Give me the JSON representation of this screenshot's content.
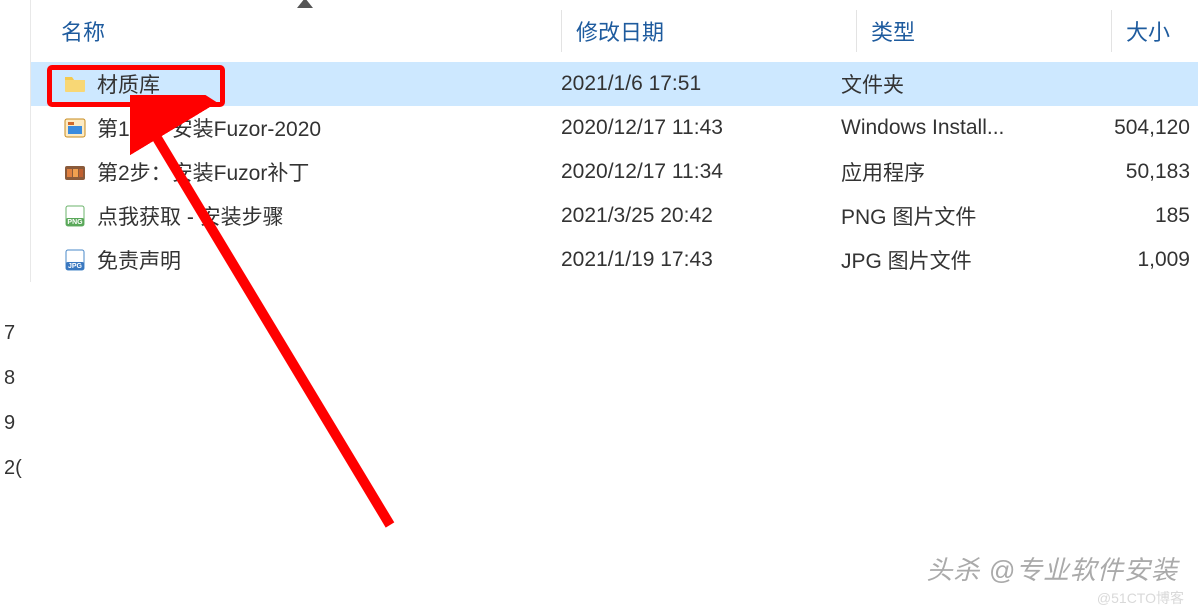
{
  "left_strip": [
    "7",
    "8",
    "9",
    "2("
  ],
  "columns": {
    "name": "名称",
    "date": "修改日期",
    "type": "类型",
    "size": "大小"
  },
  "rows": [
    {
      "name": "材质库",
      "date": "2021/1/6 17:51",
      "type": "文件夹",
      "size": "",
      "icon": "folder",
      "selected": true
    },
    {
      "name": "第1步：安装Fuzor-2020",
      "date": "2020/12/17 11:43",
      "type": "Windows Install...",
      "size": "504,120",
      "icon": "msi",
      "selected": false
    },
    {
      "name": "第2步：安装Fuzor补丁",
      "date": "2020/12/17 11:34",
      "type": "应用程序",
      "size": "50,183",
      "icon": "exe",
      "selected": false
    },
    {
      "name": "点我获取 - 安装步骤",
      "date": "2021/3/25 20:42",
      "type": "PNG 图片文件",
      "size": "185",
      "icon": "png",
      "selected": false
    },
    {
      "name": "免责声明",
      "date": "2021/1/19 17:43",
      "type": "JPG 图片文件",
      "size": "1,009",
      "icon": "jpg",
      "selected": false
    }
  ],
  "watermark_main": "头杀 @专业软件安装",
  "watermark_sub": "@51CTO博客"
}
